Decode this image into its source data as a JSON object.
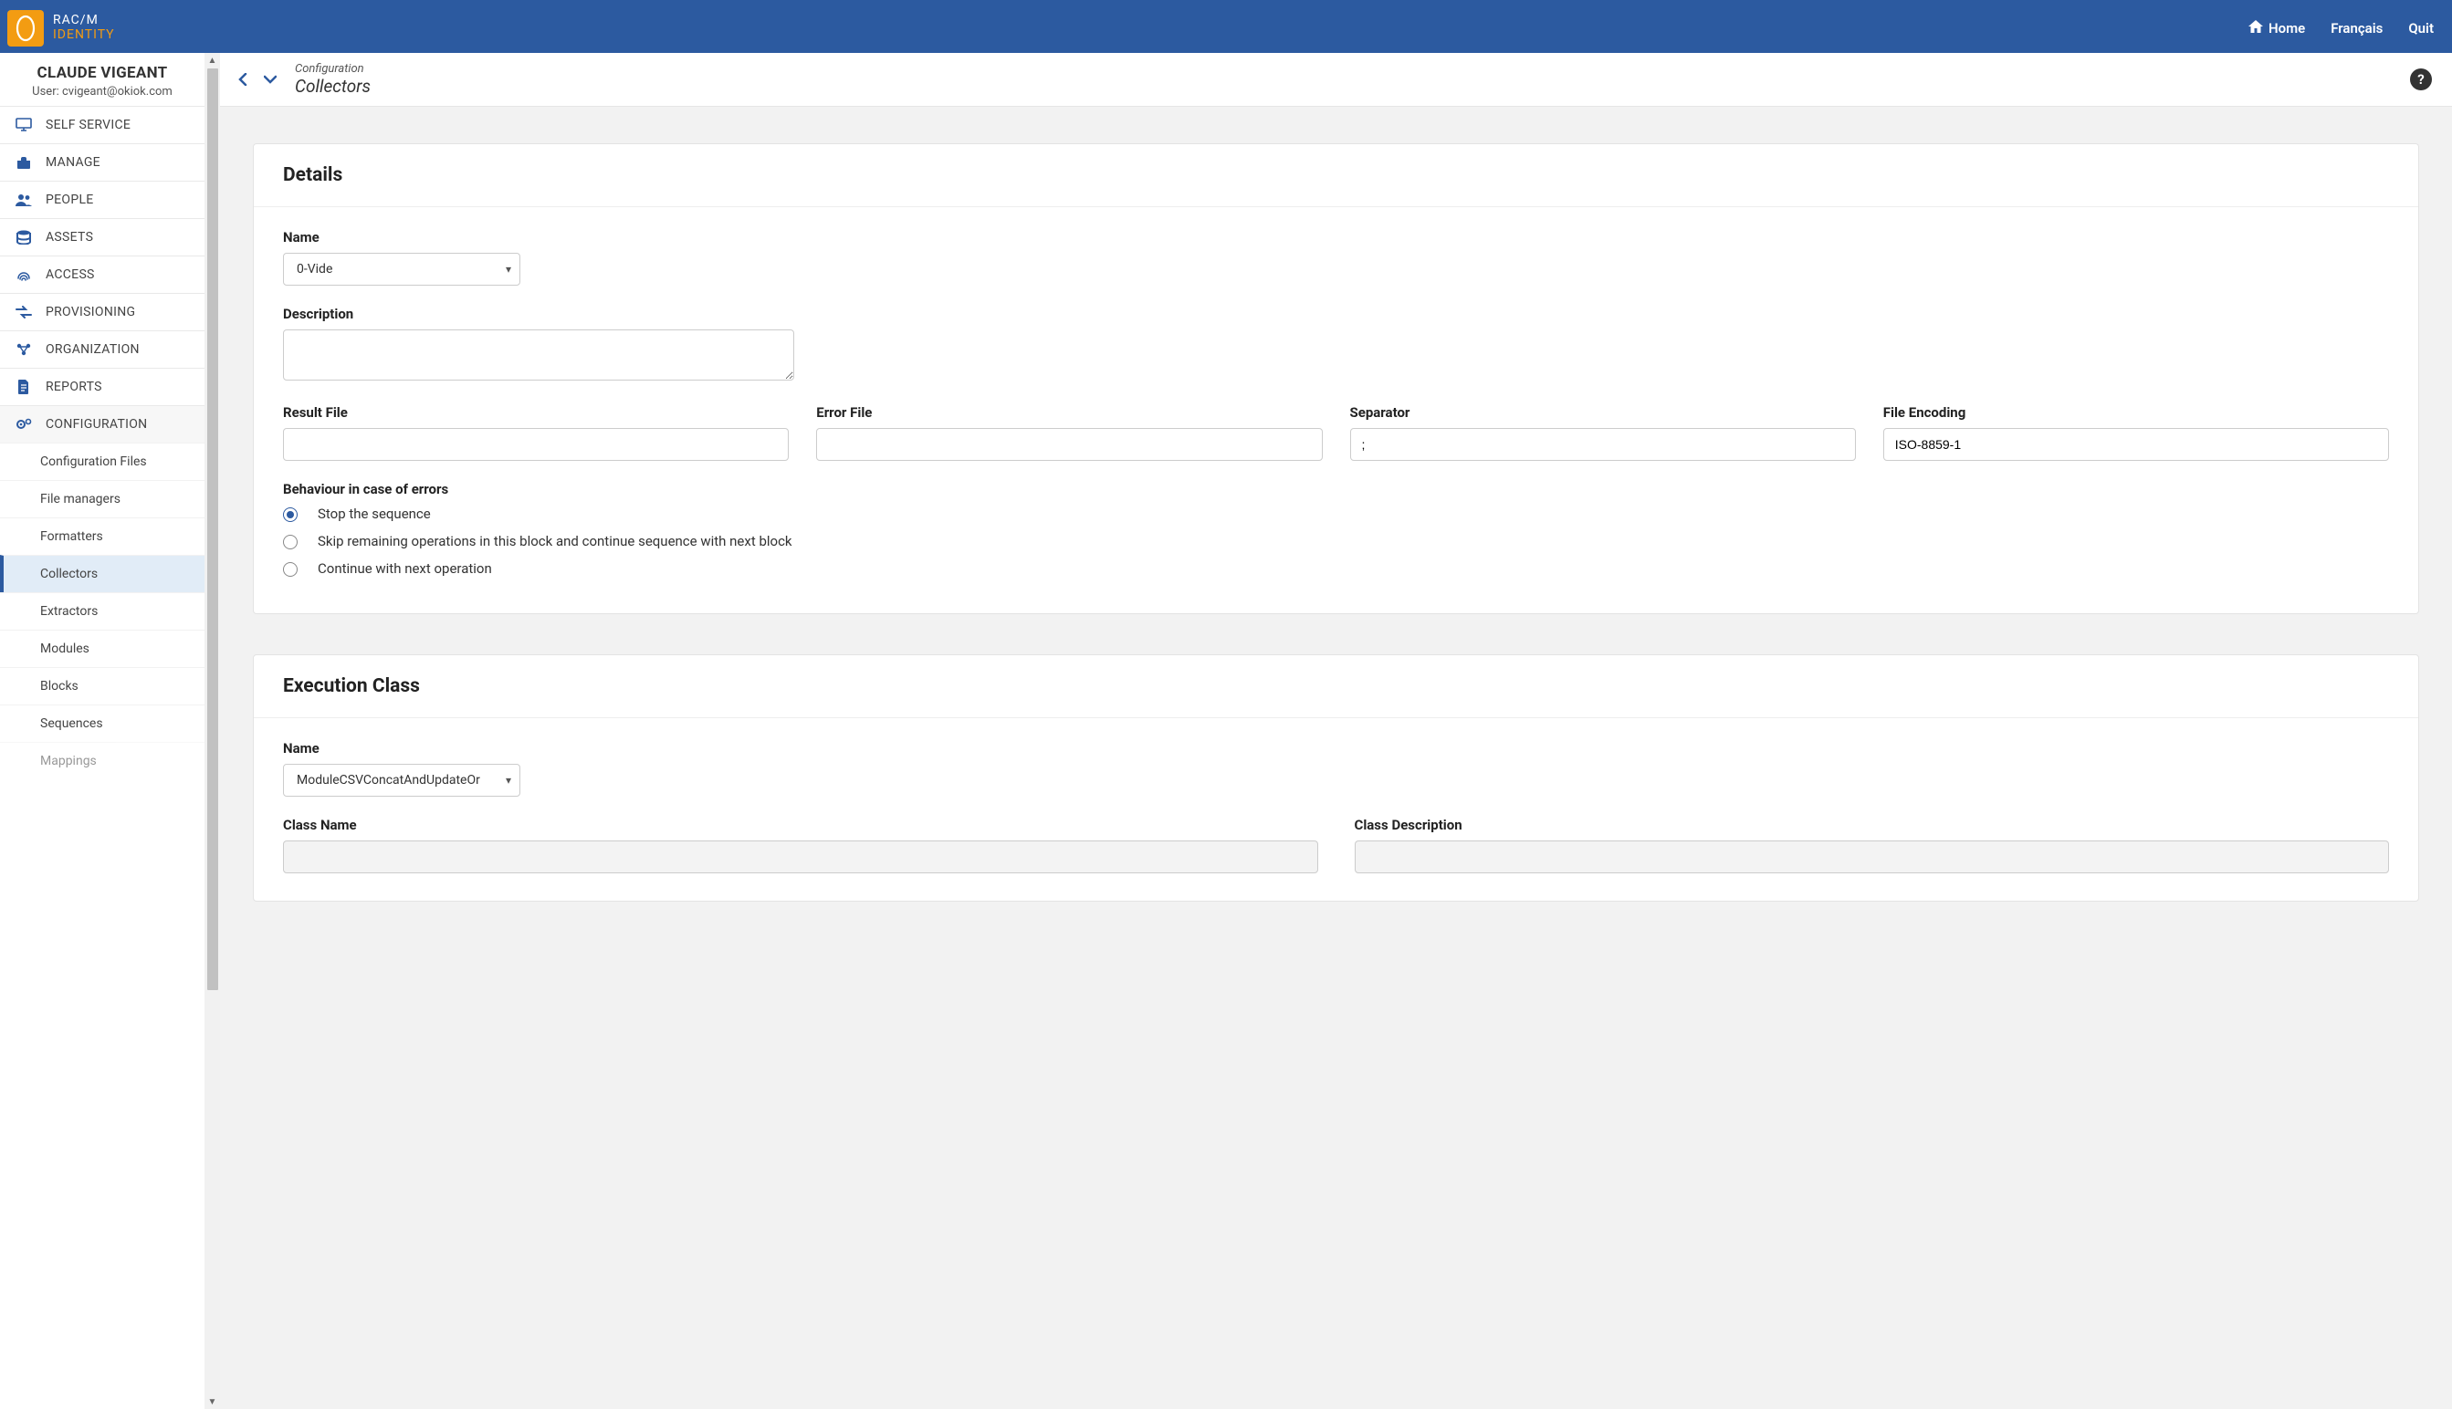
{
  "brand": {
    "top": "RAC/M",
    "bottom": "IDENTITY"
  },
  "header": {
    "home": "Home",
    "lang": "Français",
    "quit": "Quit"
  },
  "user": {
    "name": "CLAUDE VIGEANT",
    "sub": "User: cvigeant@okiok.com"
  },
  "sidebar": {
    "items": [
      {
        "label": "SELF SERVICE"
      },
      {
        "label": "MANAGE"
      },
      {
        "label": "PEOPLE"
      },
      {
        "label": "ASSETS"
      },
      {
        "label": "ACCESS"
      },
      {
        "label": "PROVISIONING"
      },
      {
        "label": "ORGANIZATION"
      },
      {
        "label": "REPORTS"
      },
      {
        "label": "CONFIGURATION"
      }
    ],
    "config_sub": [
      {
        "label": "Configuration Files"
      },
      {
        "label": "File managers"
      },
      {
        "label": "Formatters"
      },
      {
        "label": "Collectors"
      },
      {
        "label": "Extractors"
      },
      {
        "label": "Modules"
      },
      {
        "label": "Blocks"
      },
      {
        "label": "Sequences"
      },
      {
        "label": "Mappings"
      }
    ]
  },
  "breadcrumb": {
    "parent": "Configuration",
    "current": "Collectors"
  },
  "details": {
    "title": "Details",
    "labels": {
      "name": "Name",
      "description": "Description",
      "result_file": "Result File",
      "error_file": "Error File",
      "separator": "Separator",
      "file_encoding": "File Encoding",
      "behaviour": "Behaviour in case of errors"
    },
    "values": {
      "name": "0-Vide",
      "description": "",
      "result_file": "",
      "error_file": "",
      "separator": ";",
      "file_encoding": "ISO-8859-1"
    },
    "radios": [
      "Stop the sequence",
      "Skip remaining operations in this block and continue sequence with next block",
      "Continue with next operation"
    ]
  },
  "exec": {
    "title": "Execution Class",
    "labels": {
      "name": "Name",
      "class_name": "Class Name",
      "class_description": "Class Description"
    },
    "values": {
      "name": "ModuleCSVConcatAndUpdateOr"
    }
  },
  "help": "?"
}
